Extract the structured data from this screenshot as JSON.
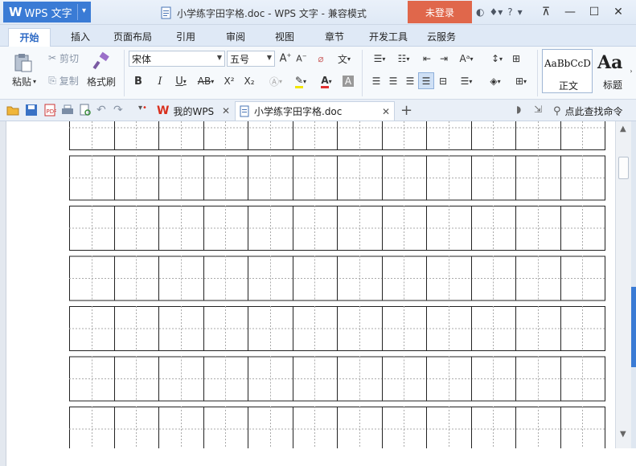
{
  "window": {
    "app_logo": "W",
    "app_name": "WPS 文字",
    "doc_title": "小学练字田字格.doc - WPS 文字 - 兼容模式",
    "login_label": "未登录",
    "help_label": "?",
    "minimize": "—",
    "restore": "☐",
    "close": "✕"
  },
  "ribbon_tabs": [
    {
      "label": "开始",
      "active": true
    },
    {
      "label": "插入"
    },
    {
      "label": "页面布局"
    },
    {
      "label": "引用"
    },
    {
      "label": "审阅"
    },
    {
      "label": "视图"
    },
    {
      "label": "章节"
    },
    {
      "label": "开发工具"
    },
    {
      "label": "云服务"
    }
  ],
  "clipboard": {
    "paste": "粘贴",
    "cut": "剪切",
    "copy": "复制",
    "format_painter": "格式刷"
  },
  "font": {
    "family": "宋体",
    "size": "五号",
    "bold": "B",
    "italic": "I",
    "underline": "U",
    "strike": "AB",
    "superscript": "X²",
    "subscript": "X₂",
    "phonetic": "文"
  },
  "styles": {
    "normal_sample": "AaBbCcD",
    "normal_label": "正文",
    "heading_sample": "Aa",
    "heading_label": "标题"
  },
  "doc_tabs": [
    {
      "label": "我的WPS"
    },
    {
      "label": "小学练字田字格.doc",
      "active": true
    }
  ],
  "search_placeholder": "点此查找命令",
  "page": {
    "rows_visible": 7,
    "cols": 12,
    "grid_style": "tianzige"
  }
}
